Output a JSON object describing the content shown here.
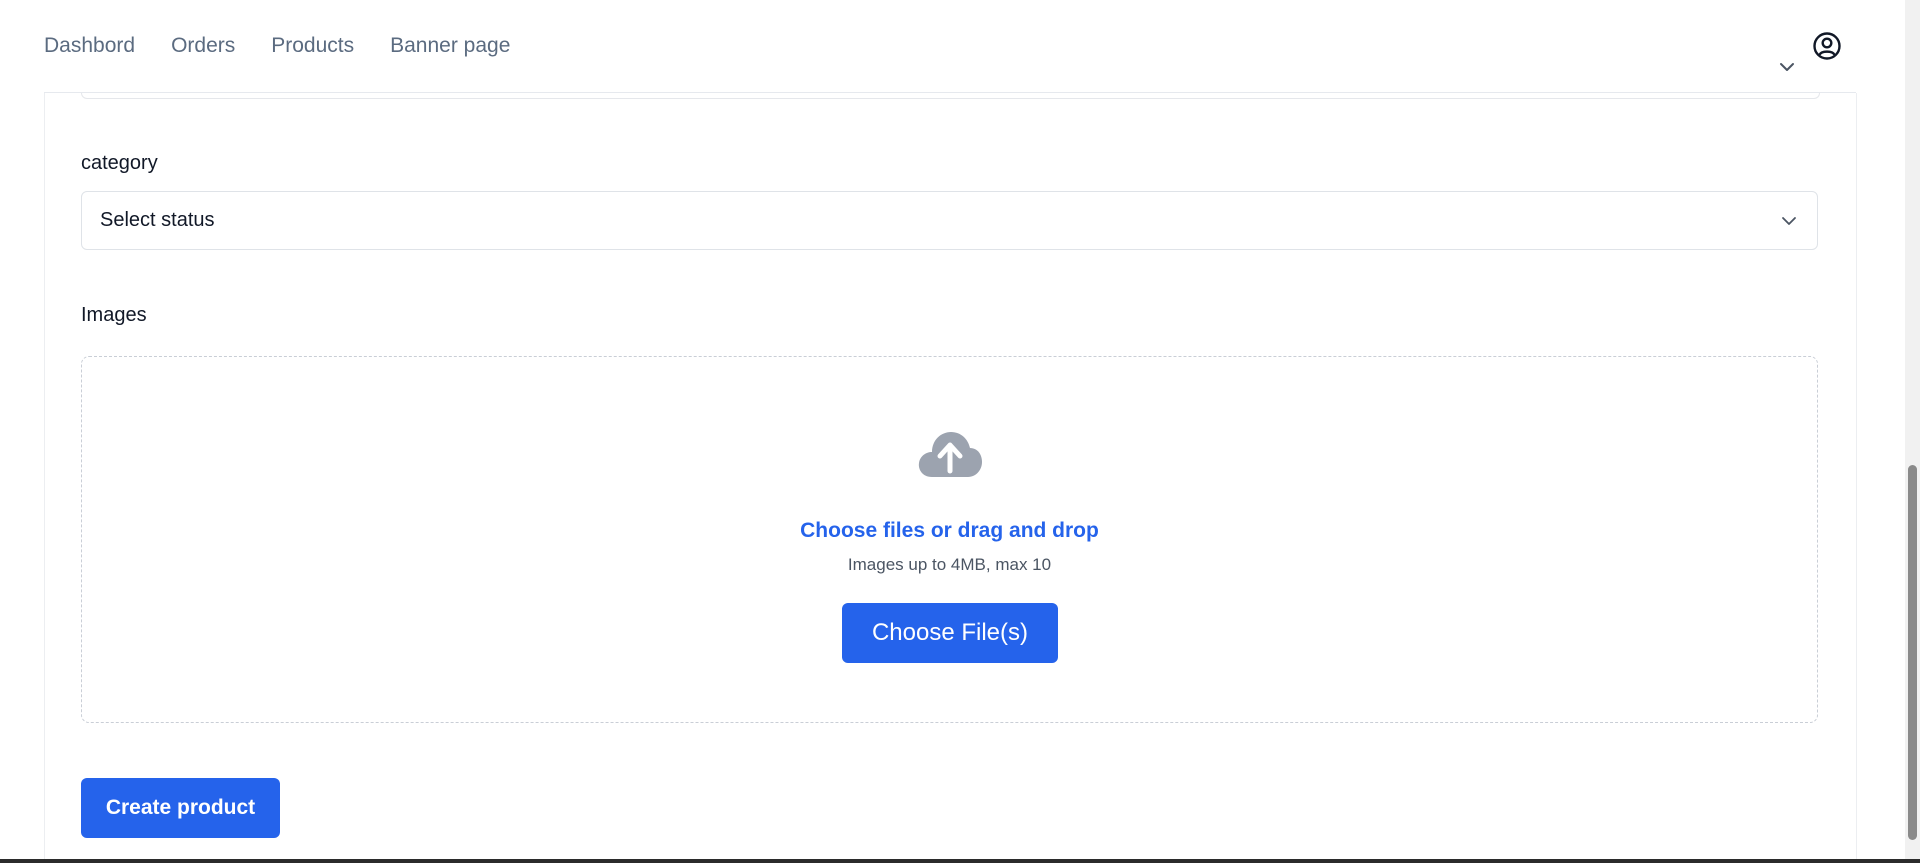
{
  "nav": {
    "links": [
      "Dashbord",
      "Orders",
      "Products",
      "Banner page"
    ]
  },
  "icons": {
    "account": "account-circle-icon",
    "account_chevron": "chevron-down-icon",
    "select_chevron": "chevron-down-icon",
    "upload": "cloud-upload-icon"
  },
  "form": {
    "category_label": "category",
    "category_select_value": "Select status",
    "images_label": "Images",
    "dropzone": {
      "link_text": "Choose files or drag and drop",
      "hint": "Images up to 4MB, max 10",
      "button_label": "Choose File(s)"
    },
    "submit_label": "Create product"
  },
  "colors": {
    "primary": "#2563eb",
    "nav_text": "#5b6b80",
    "icon_gray": "#9ca3af"
  }
}
